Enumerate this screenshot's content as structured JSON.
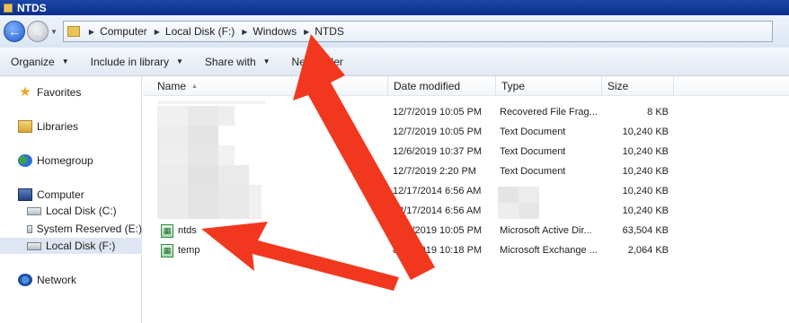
{
  "window": {
    "title": "NTDS"
  },
  "address": {
    "crumbs": [
      "Computer",
      "Local Disk (F:)",
      "Windows",
      "NTDS"
    ]
  },
  "toolbar": {
    "organize": "Organize",
    "include": "Include in library",
    "share": "Share with",
    "newfolder": "New folder"
  },
  "nav": {
    "favorites": "Favorites",
    "libraries": "Libraries",
    "homegroup": "Homegroup",
    "computer": "Computer",
    "disk_c": "Local Disk (C:)",
    "disk_e": "System Reserved (E:)",
    "disk_f": "Local Disk (F:)",
    "network": "Network"
  },
  "columns": {
    "name": "Name",
    "date": "Date modified",
    "type": "Type",
    "size": "Size"
  },
  "files": [
    {
      "name": "",
      "date": "12/7/2019 10:05 PM",
      "type": "Recovered File Frag...",
      "size": "8 KB"
    },
    {
      "name": "",
      "date": "12/7/2019 10:05 PM",
      "type": "Text Document",
      "size": "10,240 KB"
    },
    {
      "name": "",
      "date": "12/6/2019 10:37 PM",
      "type": "Text Document",
      "size": "10,240 KB"
    },
    {
      "name": "",
      "date": "12/7/2019 2:20 PM",
      "type": "Text Document",
      "size": "10,240 KB"
    },
    {
      "name": "",
      "date": "12/17/2014 6:56 AM",
      "type": "",
      "size": "10,240 KB"
    },
    {
      "name": "",
      "date": "12/17/2014 6:56 AM",
      "type": "",
      "size": "10,240 KB"
    },
    {
      "name": "ntds",
      "date": "12/7/2019 10:05 PM",
      "type": "Microsoft Active Dir...",
      "size": "63,504 KB"
    },
    {
      "name": "temp",
      "date": "8/1_/2019 10:18 PM",
      "type": "Microsoft Exchange ...",
      "size": "2,064 KB"
    }
  ],
  "colors": {
    "titlebar": "#0c2f8a",
    "selection": "#dde6f2",
    "arrow": "#f2371f"
  },
  "icons": {
    "back": "back-arrow-icon",
    "forward": "forward-arrow-icon",
    "favorites": "star-icon",
    "libraries": "library-icon",
    "homegroup": "homegroup-icon",
    "computer": "computer-icon",
    "disk": "disk-icon",
    "network": "network-icon",
    "file": "db-file-icon"
  }
}
